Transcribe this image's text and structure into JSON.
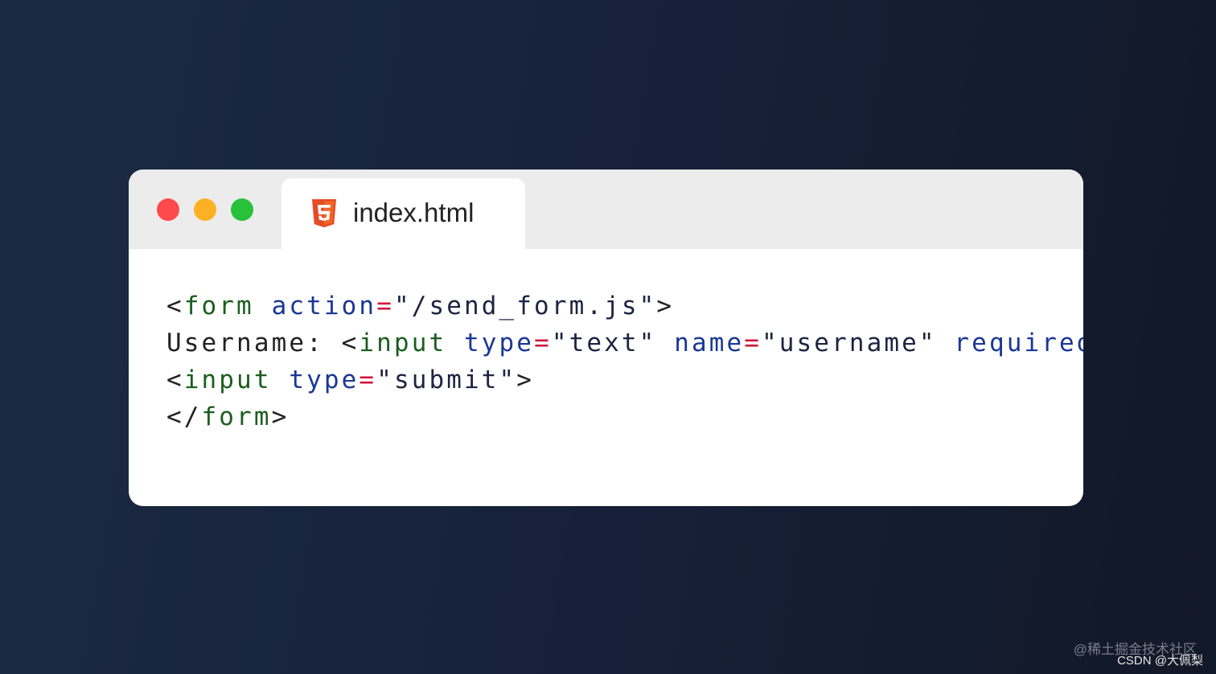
{
  "window": {
    "tab_label": "index.html",
    "tab_icon": "html5-icon",
    "traffic_lights": [
      "#fe4a4a",
      "#feb024",
      "#27c13a"
    ]
  },
  "colors": {
    "tag": "#1c5e1e",
    "attr": "#1a3796",
    "eq": "#d3143c",
    "str": "#1c2442",
    "punct": "#222222",
    "text": "#222222"
  },
  "code": [
    [
      {
        "t": "<",
        "c": "punct"
      },
      {
        "t": "form",
        "c": "tag"
      },
      {
        "t": " ",
        "c": "text"
      },
      {
        "t": "action",
        "c": "attr"
      },
      {
        "t": "=",
        "c": "eq"
      },
      {
        "t": "\"/send_form.js\"",
        "c": "str"
      },
      {
        "t": ">",
        "c": "punct"
      }
    ],
    [
      {
        "t": "Username: ",
        "c": "text"
      },
      {
        "t": "<",
        "c": "punct"
      },
      {
        "t": "input",
        "c": "tag"
      },
      {
        "t": " ",
        "c": "text"
      },
      {
        "t": "type",
        "c": "attr"
      },
      {
        "t": "=",
        "c": "eq"
      },
      {
        "t": "\"text\"",
        "c": "str"
      },
      {
        "t": " ",
        "c": "text"
      },
      {
        "t": "name",
        "c": "attr"
      },
      {
        "t": "=",
        "c": "eq"
      },
      {
        "t": "\"username\"",
        "c": "str"
      },
      {
        "t": " ",
        "c": "text"
      },
      {
        "t": "required",
        "c": "attr"
      },
      {
        "t": ">",
        "c": "punct"
      }
    ],
    [
      {
        "t": "<",
        "c": "punct"
      },
      {
        "t": "input",
        "c": "tag"
      },
      {
        "t": " ",
        "c": "text"
      },
      {
        "t": "type",
        "c": "attr"
      },
      {
        "t": "=",
        "c": "eq"
      },
      {
        "t": "\"submit\"",
        "c": "str"
      },
      {
        "t": ">",
        "c": "punct"
      }
    ],
    [
      {
        "t": "</",
        "c": "punct"
      },
      {
        "t": "form",
        "c": "tag"
      },
      {
        "t": ">",
        "c": "punct"
      }
    ]
  ],
  "watermarks": {
    "juejin": "@稀土掘金技术社区",
    "csdn": "CSDN @大佩梨"
  }
}
